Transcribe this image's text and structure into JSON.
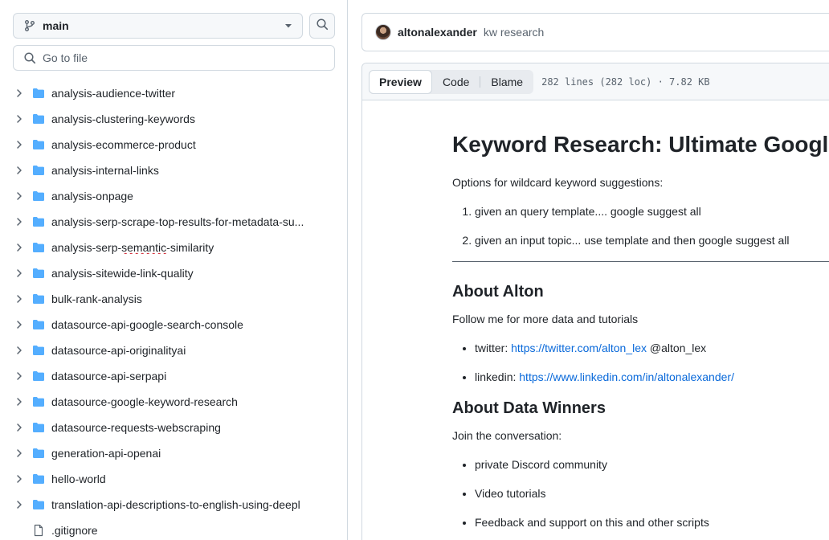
{
  "sidebar": {
    "branch": {
      "name": "main",
      "icon": "git-branch-icon"
    },
    "search_icon": "search-icon",
    "goto_placeholder": "Go to file",
    "tree": [
      {
        "type": "folder",
        "name": "analysis-audience-twitter"
      },
      {
        "type": "folder",
        "name": "analysis-clustering-keywords"
      },
      {
        "type": "folder",
        "name": "analysis-ecommerce-product"
      },
      {
        "type": "folder",
        "name": "analysis-internal-links"
      },
      {
        "type": "folder",
        "name": "analysis-onpage"
      },
      {
        "type": "folder",
        "name": "analysis-serp-scrape-top-results-for-metadata-su..."
      },
      {
        "type": "folder",
        "name": "analysis-serp-semantic-similarity"
      },
      {
        "type": "folder",
        "name": "analysis-sitewide-link-quality"
      },
      {
        "type": "folder",
        "name": "bulk-rank-analysis"
      },
      {
        "type": "folder",
        "name": "datasource-api-google-search-console"
      },
      {
        "type": "folder",
        "name": "datasource-api-originalityai"
      },
      {
        "type": "folder",
        "name": "datasource-api-serpapi"
      },
      {
        "type": "folder",
        "name": "datasource-google-keyword-research"
      },
      {
        "type": "folder",
        "name": "datasource-requests-webscraping"
      },
      {
        "type": "folder",
        "name": "generation-api-openai"
      },
      {
        "type": "folder",
        "name": "hello-world"
      },
      {
        "type": "folder",
        "name": "translation-api-descriptions-to-english-using-deepl"
      },
      {
        "type": "file",
        "name": ".gitignore"
      }
    ]
  },
  "commit": {
    "author": "altonalexander",
    "message": "kw research"
  },
  "file_header": {
    "tabs": [
      "Preview",
      "Code",
      "Blame"
    ],
    "active_tab": "Preview",
    "meta": "282 lines (282 loc) · 7.82 KB"
  },
  "readme": {
    "title": "Keyword Research: Ultimate Google Suggest",
    "intro": "Options for wildcard keyword suggestions:",
    "options": [
      "given an query template.... google suggest all",
      "given an input topic... use template and then google suggest all"
    ],
    "about_heading": "About Alton",
    "about_text": "Follow me for more data and tutorials",
    "twitter_label": "twitter:",
    "twitter_url": "https://twitter.com/alton_lex",
    "twitter_handle": "@alton_lex",
    "linkedin_label": "linkedin:",
    "linkedin_url": "https://www.linkedin.com/in/altonalexander/",
    "dw_heading": "About Data Winners",
    "dw_text": "Join the conversation:",
    "dw_items": [
      "private Discord community",
      "Video tutorials",
      "Feedback and support on this and other scripts"
    ]
  },
  "colors": {
    "folder": "#54aeff",
    "link": "#0969da",
    "border": "#d1d9e0",
    "muted": "#59636e"
  }
}
